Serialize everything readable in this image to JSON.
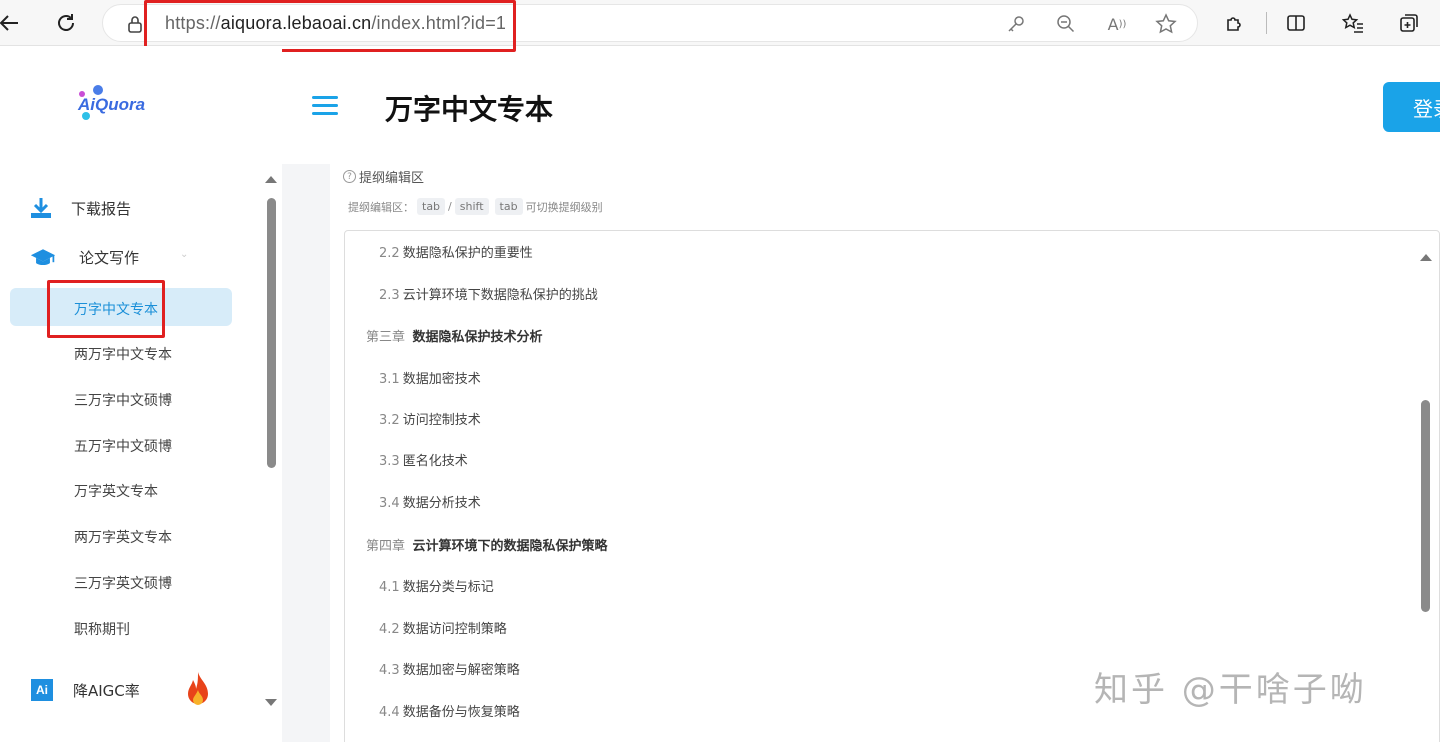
{
  "browser": {
    "url_prefix": "https://",
    "url_host": "aiquora.lebaoai.cn",
    "url_path": "/index.html?id=1"
  },
  "sidebar": {
    "logo_text": "AiQuora",
    "download": "下载报告",
    "thesis": "论文写作",
    "sub_items": [
      "万字中文专本",
      "两万字中文专本",
      "三万字中文硕博",
      "五万字中文硕博",
      "万字英文专本",
      "两万字英文专本",
      "三万字英文硕博",
      "职称期刊"
    ],
    "aigc": "降AIGC率",
    "aigc_badge": "Ai"
  },
  "header": {
    "title": "万字中文专本",
    "login": "登录"
  },
  "editor": {
    "help_label": "提纲编辑区",
    "hint_prefix": "提纲编辑区：",
    "key1": "tab",
    "slash": "/",
    "key2": "shift",
    "key3": "tab",
    "hint_suffix": "可切换提纲级别"
  },
  "outline": [
    {
      "num": "2.2",
      "text": "数据隐私保护的重要性",
      "level": 2
    },
    {
      "num": "2.3",
      "text": "云计算环境下数据隐私保护的挑战",
      "level": 2
    },
    {
      "num": "第三章",
      "text": "数据隐私保护技术分析",
      "level": 1
    },
    {
      "num": "3.1",
      "text": "数据加密技术",
      "level": 2
    },
    {
      "num": "3.2",
      "text": "访问控制技术",
      "level": 2
    },
    {
      "num": "3.3",
      "text": "匿名化技术",
      "level": 2
    },
    {
      "num": "3.4",
      "text": "数据分析技术",
      "level": 2
    },
    {
      "num": "第四章",
      "text": "云计算环境下的数据隐私保护策略",
      "level": 1
    },
    {
      "num": "4.1",
      "text": "数据分类与标记",
      "level": 2
    },
    {
      "num": "4.2",
      "text": "数据访问控制策略",
      "level": 2
    },
    {
      "num": "4.3",
      "text": "数据加密与解密策略",
      "level": 2
    },
    {
      "num": "4.4",
      "text": "数据备份与恢复策略",
      "level": 2
    }
  ],
  "watermark": "知乎 @干啥子呦",
  "colors": {
    "accent": "#1aa3e8",
    "highlight": "#e02020",
    "active_bg": "#d7ecf9"
  }
}
